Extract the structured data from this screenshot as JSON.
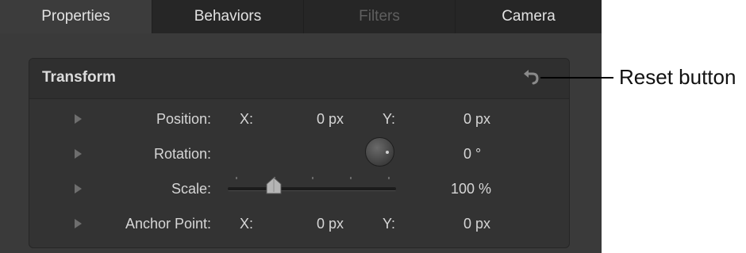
{
  "tabs": [
    {
      "label": "Properties",
      "state": "active"
    },
    {
      "label": "Behaviors",
      "state": "normal"
    },
    {
      "label": "Filters",
      "state": "disabled"
    },
    {
      "label": "Camera",
      "state": "normal"
    }
  ],
  "transform": {
    "title": "Transform",
    "reset_icon": "reset-arrow-icon",
    "rows": {
      "position": {
        "label": "Position:",
        "x_label": "X:",
        "x_value": "0 px",
        "y_label": "Y:",
        "y_value": "0 px"
      },
      "rotation": {
        "label": "Rotation:",
        "value": "0 °"
      },
      "scale": {
        "label": "Scale:",
        "value": "100 %",
        "slider_level": 0.27
      },
      "anchor": {
        "label": "Anchor Point:",
        "x_label": "X:",
        "x_value": "0 px",
        "y_label": "Y:",
        "y_value": "0 px"
      }
    }
  },
  "annotation": {
    "label": "Reset button"
  },
  "colors": {
    "panel": "#3a3a3a",
    "tabbar": "#262626",
    "text": "#d6d6d6",
    "disabled": "#5f5f5f"
  }
}
